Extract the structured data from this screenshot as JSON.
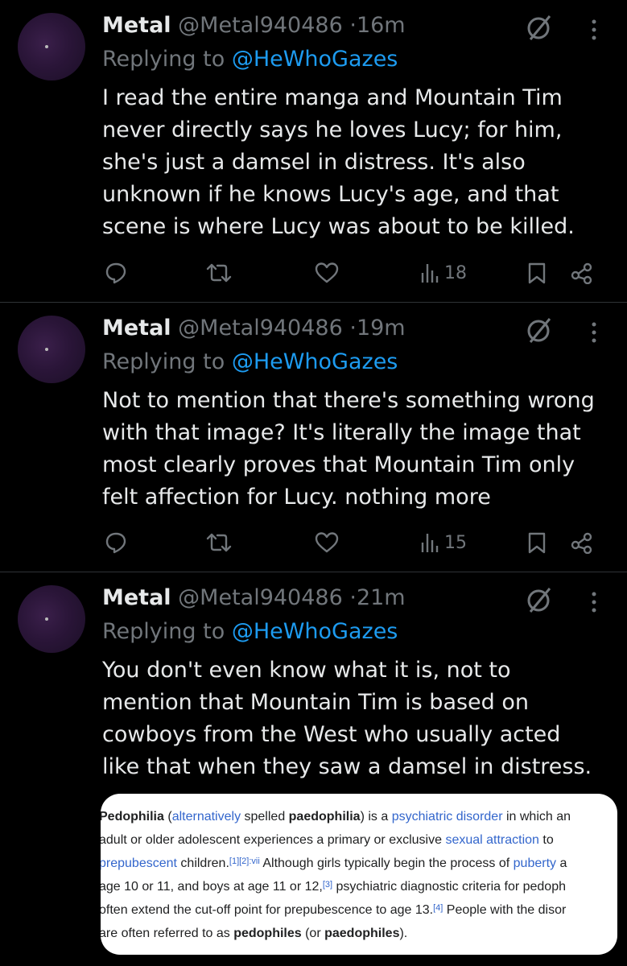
{
  "tweets": [
    {
      "name": "Metal",
      "handle": "@Metal940486",
      "separator": "·",
      "time": "16m",
      "replying_prefix": "Replying to",
      "replying_to": "@HeWhoGazes",
      "lines": [
        "I read the entire manga and Mountain Tim",
        "never directly says he loves Lucy; for him,",
        "she's just a damsel in distress. It's also",
        "unknown if he knows Lucy's age, and that",
        "scene is where Lucy was about to be killed."
      ],
      "views": "18"
    },
    {
      "name": "Metal",
      "handle": "@Metal940486",
      "separator": "·",
      "time": "19m",
      "replying_prefix": "Replying to",
      "replying_to": "@HeWhoGazes",
      "lines": [
        "Not to mention that there's something wrong",
        "with that image? It's literally the image that",
        "most clearly proves that Mountain Tim only",
        "felt affection for Lucy. nothing more"
      ],
      "views": "15"
    },
    {
      "name": "Metal",
      "handle": "@Metal940486",
      "separator": "·",
      "time": "21m",
      "replying_prefix": "Replying to",
      "replying_to": "@HeWhoGazes",
      "lines": [
        "You don't even know what it is, not to",
        "mention that Mountain Tim is based on",
        "cowboys from the West who usually acted",
        "like that when they saw a damsel in distress."
      ]
    }
  ],
  "wiki": {
    "l1_a": "Pedophilia",
    "l1_b": " (",
    "l1_c": "alternatively",
    "l1_d": " spelled ",
    "l1_e": "paedophilia",
    "l1_f": ") is a ",
    "l1_g": "psychiatric disorder",
    "l1_h": " in which an",
    "l2_a": "adult or older adolescent experiences a primary or exclusive ",
    "l2_b": "sexual attraction",
    "l2_c": " to",
    "l3_a": "prepubescent",
    "l3_b": " children.",
    "l3_c": "[1][2]:vii",
    "l3_d": " Although girls typically begin the process of ",
    "l3_e": "puberty",
    "l3_f": " a",
    "l4_a": "age 10 or 11, and boys at age 11 or 12,",
    "l4_b": "[3]",
    "l4_c": " psychiatric diagnostic criteria for pedoph",
    "l5_a": "often extend the cut-off point for prepubescence to age 13.",
    "l5_b": "[4]",
    "l5_c": " People with the disor",
    "l6_a": "are often referred to as ",
    "l6_b": "pedophiles",
    "l6_c": " (or ",
    "l6_d": "paedophiles",
    "l6_e": ")."
  },
  "colors": {
    "background": "#000000",
    "text": "#e7e9ea",
    "muted": "#71767b",
    "mention": "#1d9bf0",
    "divider": "#2f3336"
  }
}
